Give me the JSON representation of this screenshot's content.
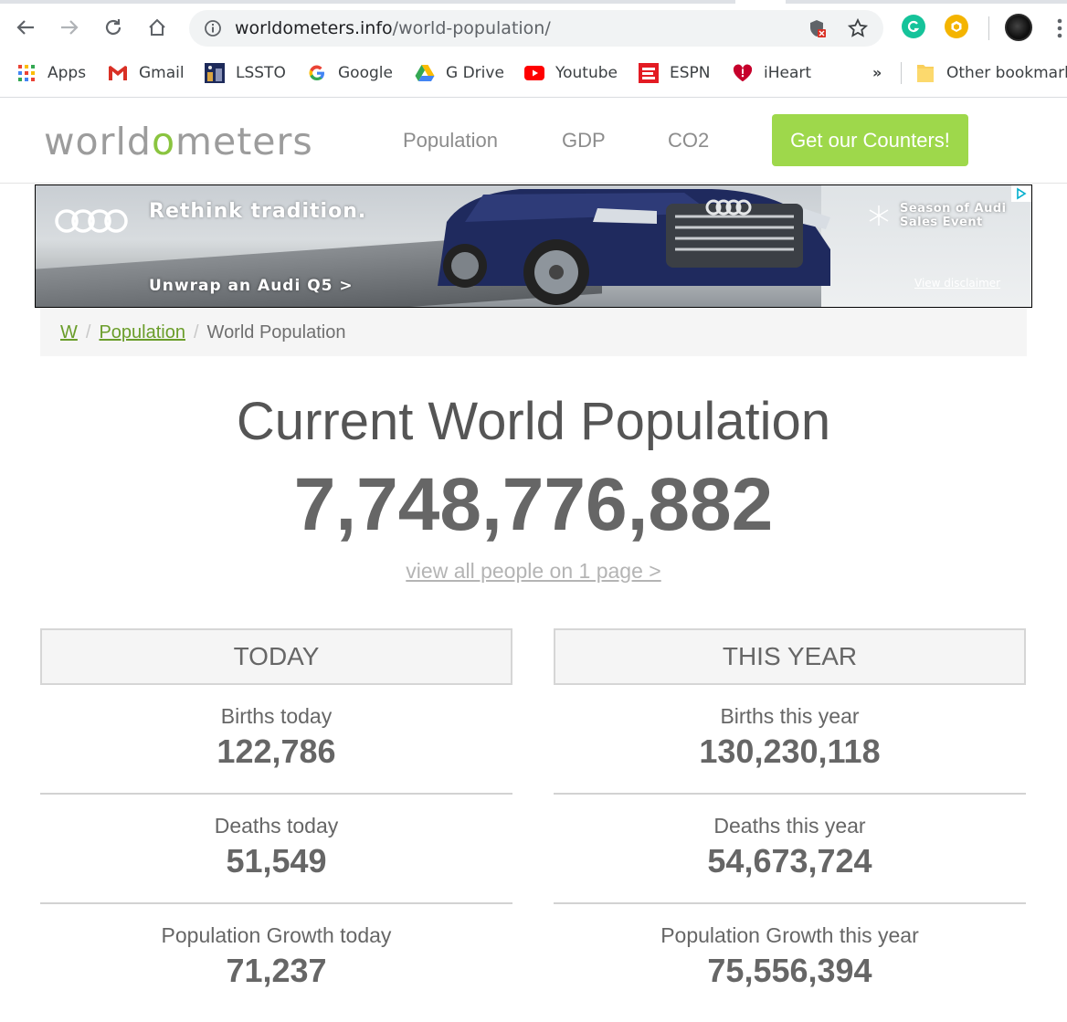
{
  "browser": {
    "url_host": "worldometers.info",
    "url_path": "/world-population/",
    "bookmarks": [
      {
        "label": "Apps",
        "icon": "apps-grid-icon"
      },
      {
        "label": "Gmail",
        "icon": "gmail-icon"
      },
      {
        "label": "LSSTO",
        "icon": "lssto-icon"
      },
      {
        "label": "Google",
        "icon": "google-icon"
      },
      {
        "label": "G Drive",
        "icon": "google-drive-icon"
      },
      {
        "label": "Youtube",
        "icon": "youtube-icon"
      },
      {
        "label": "ESPN",
        "icon": "espn-icon"
      },
      {
        "label": "iHeart",
        "icon": "iheart-icon"
      }
    ],
    "more_bookmarks": "»",
    "other_bookmarks": "Other bookmarks"
  },
  "site": {
    "logo_pre": "worldometers",
    "nav": [
      "Population",
      "GDP",
      "CO2"
    ],
    "cta": "Get our Counters!",
    "accent_color": "#9ed84b"
  },
  "ad": {
    "headline": "Rethink tradition.",
    "subline": "Unwrap an Audi Q5 >",
    "event_line1": "Season of Audi",
    "event_line2": "Sales Event",
    "disclaimer": "View disclaimer"
  },
  "breadcrumb": {
    "items": [
      "W",
      "Population"
    ],
    "current": "World Population"
  },
  "main": {
    "title": "Current World Population",
    "counter": "7,748,776,882",
    "view_all": "view all people on 1 page >"
  },
  "today": {
    "header": "TODAY",
    "stats": [
      {
        "label": "Births today",
        "value": "122,786"
      },
      {
        "label": "Deaths today",
        "value": "51,549"
      },
      {
        "label": "Population Growth today",
        "value": "71,237"
      }
    ]
  },
  "this_year": {
    "header": "THIS YEAR",
    "stats": [
      {
        "label": "Births this year",
        "value": "130,230,118"
      },
      {
        "label": "Deaths this year",
        "value": "54,673,724"
      },
      {
        "label": "Population Growth this year",
        "value": "75,556,394"
      }
    ]
  }
}
